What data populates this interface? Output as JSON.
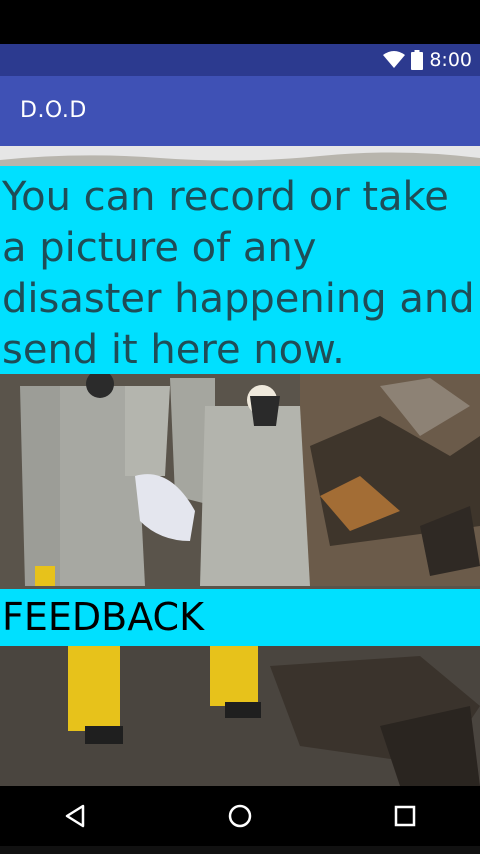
{
  "status_bar": {
    "time": "8:00",
    "icons": [
      "wifi-icon",
      "battery-icon"
    ],
    "color": "#2c3a8f"
  },
  "app_bar": {
    "title": "D.O.D",
    "color": "#3f51b5"
  },
  "main": {
    "message": "You can record or take a picture of any disaster happening and send it here now.",
    "feedback_label": "FEEDBACK",
    "accent_color": "#00e0ff",
    "background_image": "disaster-rescue-workers-photo"
  },
  "nav_bar": {
    "icons": [
      "back-icon",
      "home-icon",
      "recents-icon"
    ]
  }
}
